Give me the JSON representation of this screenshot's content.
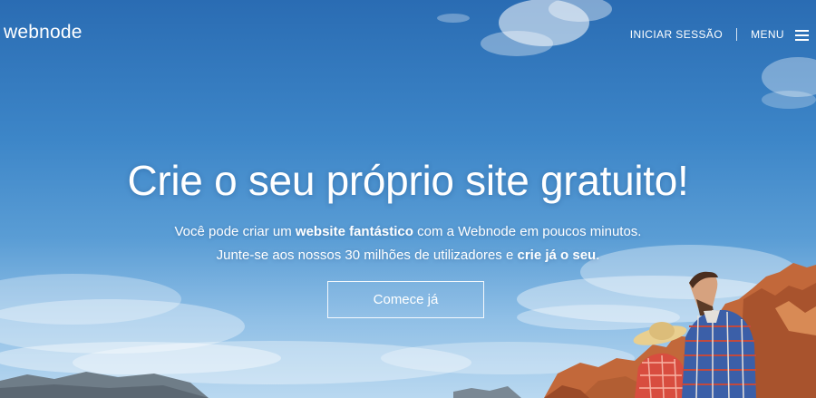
{
  "header": {
    "logo_text": "webnode",
    "login_label": "INICIAR SESSÃO",
    "menu_label": "MENU"
  },
  "hero": {
    "headline": "Crie o seu próprio site gratuito!",
    "line1_pre": "Você pode criar um ",
    "line1_bold": "website fantástico",
    "line1_post": " com a Webnode em poucos minutos.",
    "line2_pre": "Junte-se aos nossos 30 milhões de utilizadores e ",
    "line2_bold": "crie já o seu",
    "line2_post": ".",
    "cta_label": "Comece já"
  },
  "colors": {
    "sky_top": "#2a6cb3",
    "sky_bottom": "#b9d8f0",
    "text": "#ffffff"
  },
  "icons": {
    "menu": "hamburger-icon"
  }
}
